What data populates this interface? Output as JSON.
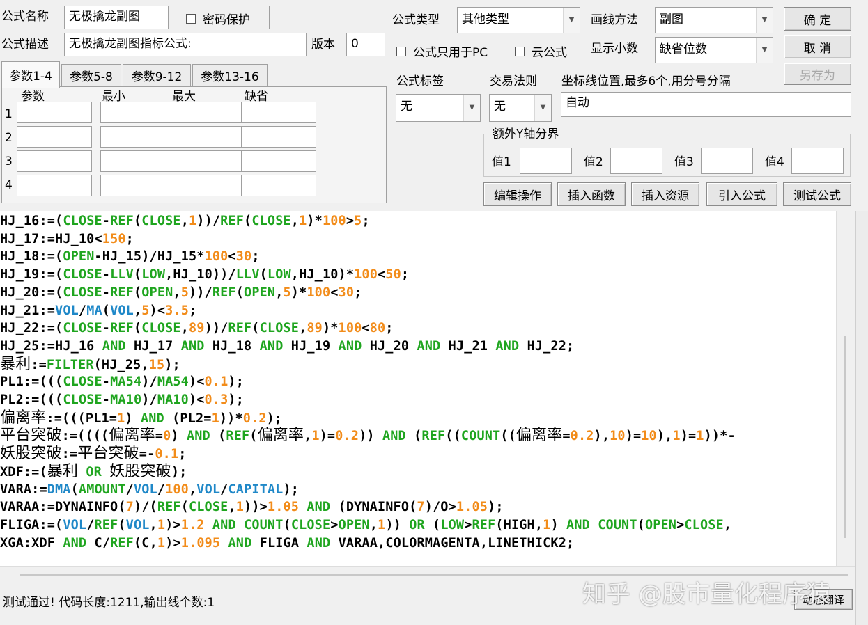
{
  "form": {
    "name_label": "公式名称",
    "name_value": "无极擒龙副图",
    "password_label": "密码保护",
    "password_value": "",
    "desc_label": "公式描述",
    "desc_value": "无极擒龙副图指标公式:",
    "version_label": "版本",
    "version_value": "0",
    "type_label": "公式类型",
    "type_value": "其他类型",
    "draw_label": "画线方法",
    "draw_value": "副图",
    "pc_only_label": "公式只用于PC",
    "cloud_label": "云公式",
    "decimals_label": "显示小数",
    "decimals_value": "缺省位数",
    "tag_label": "公式标签",
    "tag_value": "无",
    "trade_label": "交易法则",
    "trade_value": "无",
    "axis_label": "坐标线位置,最多6个,用分号分隔",
    "axis_value": "自动",
    "extra_y_label": "额外Y轴分界",
    "y_labels": [
      "值1",
      "值2",
      "值3",
      "值4"
    ]
  },
  "buttons": {
    "ok": "确 定",
    "cancel": "取 消",
    "save_as": "另存为",
    "edit_ops": "编辑操作",
    "insert_func": "插入函数",
    "insert_res": "插入资源",
    "import_formula": "引入公式",
    "test_formula": "测试公式"
  },
  "tabs": [
    "参数1-4",
    "参数5-8",
    "参数9-12",
    "参数13-16"
  ],
  "param_headers": [
    "参数",
    "最小",
    "最大",
    "缺省"
  ],
  "param_rows": [
    "1",
    "2",
    "3",
    "4"
  ],
  "status": "测试通过! 代码长度:1211,输出线个数:1",
  "watermark": "知乎 @股市量化程序猿",
  "corner_button": "动态翻译",
  "code_lines": [
    "HJ_16:=(CLOSE-REF(CLOSE,1))/REF(CLOSE,1)*100>5;",
    "HJ_17:=HJ_10<150;",
    "HJ_18:=(OPEN-HJ_15)/HJ_15*100<30;",
    "HJ_19:=(CLOSE-LLV(LOW,HJ_10))/LLV(LOW,HJ_10)*100<50;",
    "HJ_20:=(CLOSE-REF(OPEN,5))/REF(OPEN,5)*100<30;",
    "HJ_21:=VOL/MA(VOL,5)<3.5;",
    "HJ_22:=(CLOSE-REF(CLOSE,89))/REF(CLOSE,89)*100<80;",
    "HJ_25:=HJ_16 AND HJ_17 AND HJ_18 AND HJ_19 AND HJ_20 AND HJ_21 AND HJ_22;",
    "暴利:=FILTER(HJ_25,15);",
    "PL1:=(((CLOSE-MA54)/MA54)<0.1);",
    "PL2:=(((CLOSE-MA10)/MA10)<0.3);",
    "偏离率:=(((PL1=1) AND (PL2=1))*0.2);",
    "平台突破:=((((偏离率=0) AND (REF(偏离率,1)=0.2)) AND (REF((COUNT((偏离率=0.2),10)=10),1)=1))*-",
    "妖股突破:=平台突破=-0.1;",
    "XDF:=(暴利 OR 妖股突破);",
    "VARA:=DMA(AMOUNT/VOL/100,VOL/CAPITAL);",
    "VARAA:=DYNAINFO(7)/(REF(CLOSE,1))>1.05 AND (DYNAINFO(7)/O>1.05);",
    "FLIGA:=(VOL/REF(VOL,1)>1.2 AND COUNT(CLOSE>OPEN,1)) OR (LOW>REF(HIGH,1) AND COUNT(OPEN>CLOSE,",
    "XGA:XDF AND C/REF(C,1)>1.095 AND FLIGA AND VARAA,COLORMAGENTA,LINETHICK2;"
  ],
  "colors": {
    "keyword": "#1fa51f",
    "function": "#1f88c8",
    "number": "#f28c1a",
    "text": "#000000"
  }
}
